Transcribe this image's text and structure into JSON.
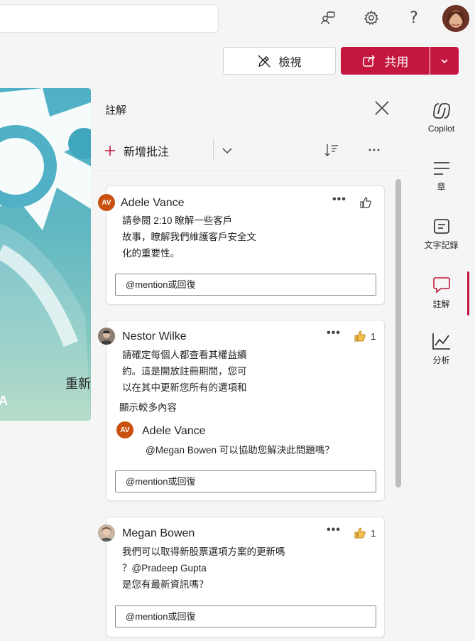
{
  "topbar": {
    "icons": [
      "people-chat-icon",
      "gear-icon",
      "help-icon",
      "user-avatar"
    ]
  },
  "actions": {
    "view_label": "檢視",
    "share_label": "共用"
  },
  "slide": {
    "letter": "A",
    "overlay_text": "重新登入"
  },
  "comments_panel": {
    "title": "註解",
    "new_comment_label": "新增批注",
    "comments": [
      {
        "author": "Adele Vance",
        "initials": "AV",
        "lines": [
          "請參閱 2:10 瞭解一些客戶",
          "故事，瞭解我們維護客戶安全文",
          "化的重要性。"
        ],
        "likes": "",
        "reply_placeholder": "@mention或回復"
      },
      {
        "author": "Nestor Wilke",
        "lines": [
          "請確定每個人都查看其權益續",
          "約。這是開放註冊期間，您可",
          "以在其中更新您所有的選項和"
        ],
        "more_label": "顯示較多內容",
        "likes": "1",
        "reply": {
          "author": "Adele Vance",
          "initials": "AV",
          "text": "@Megan Bowen 可以協助您解決此問題嗎？"
        },
        "reply_placeholder": "@mention或回復"
      },
      {
        "author": "Megan Bowen",
        "lines": [
          "我們可以取得新股票選項方案的更新嗎",
          "？@Pradeep Gupta",
          "是您有最新資訊嗎？"
        ],
        "likes": "1",
        "reply_placeholder": "@mention或回復"
      }
    ]
  },
  "rail": {
    "items": [
      {
        "label": "Copilot",
        "icon": "copilot-icon"
      },
      {
        "label": "章",
        "icon": "chapters-icon"
      },
      {
        "label": "文字記錄",
        "icon": "transcript-icon"
      },
      {
        "label": "註解",
        "icon": "comment-icon"
      },
      {
        "label": "分析",
        "icon": "analytics-icon"
      }
    ],
    "active": "註解"
  },
  "colors": {
    "accent": "#c4163f",
    "avatar_orange": "#ca5010"
  }
}
